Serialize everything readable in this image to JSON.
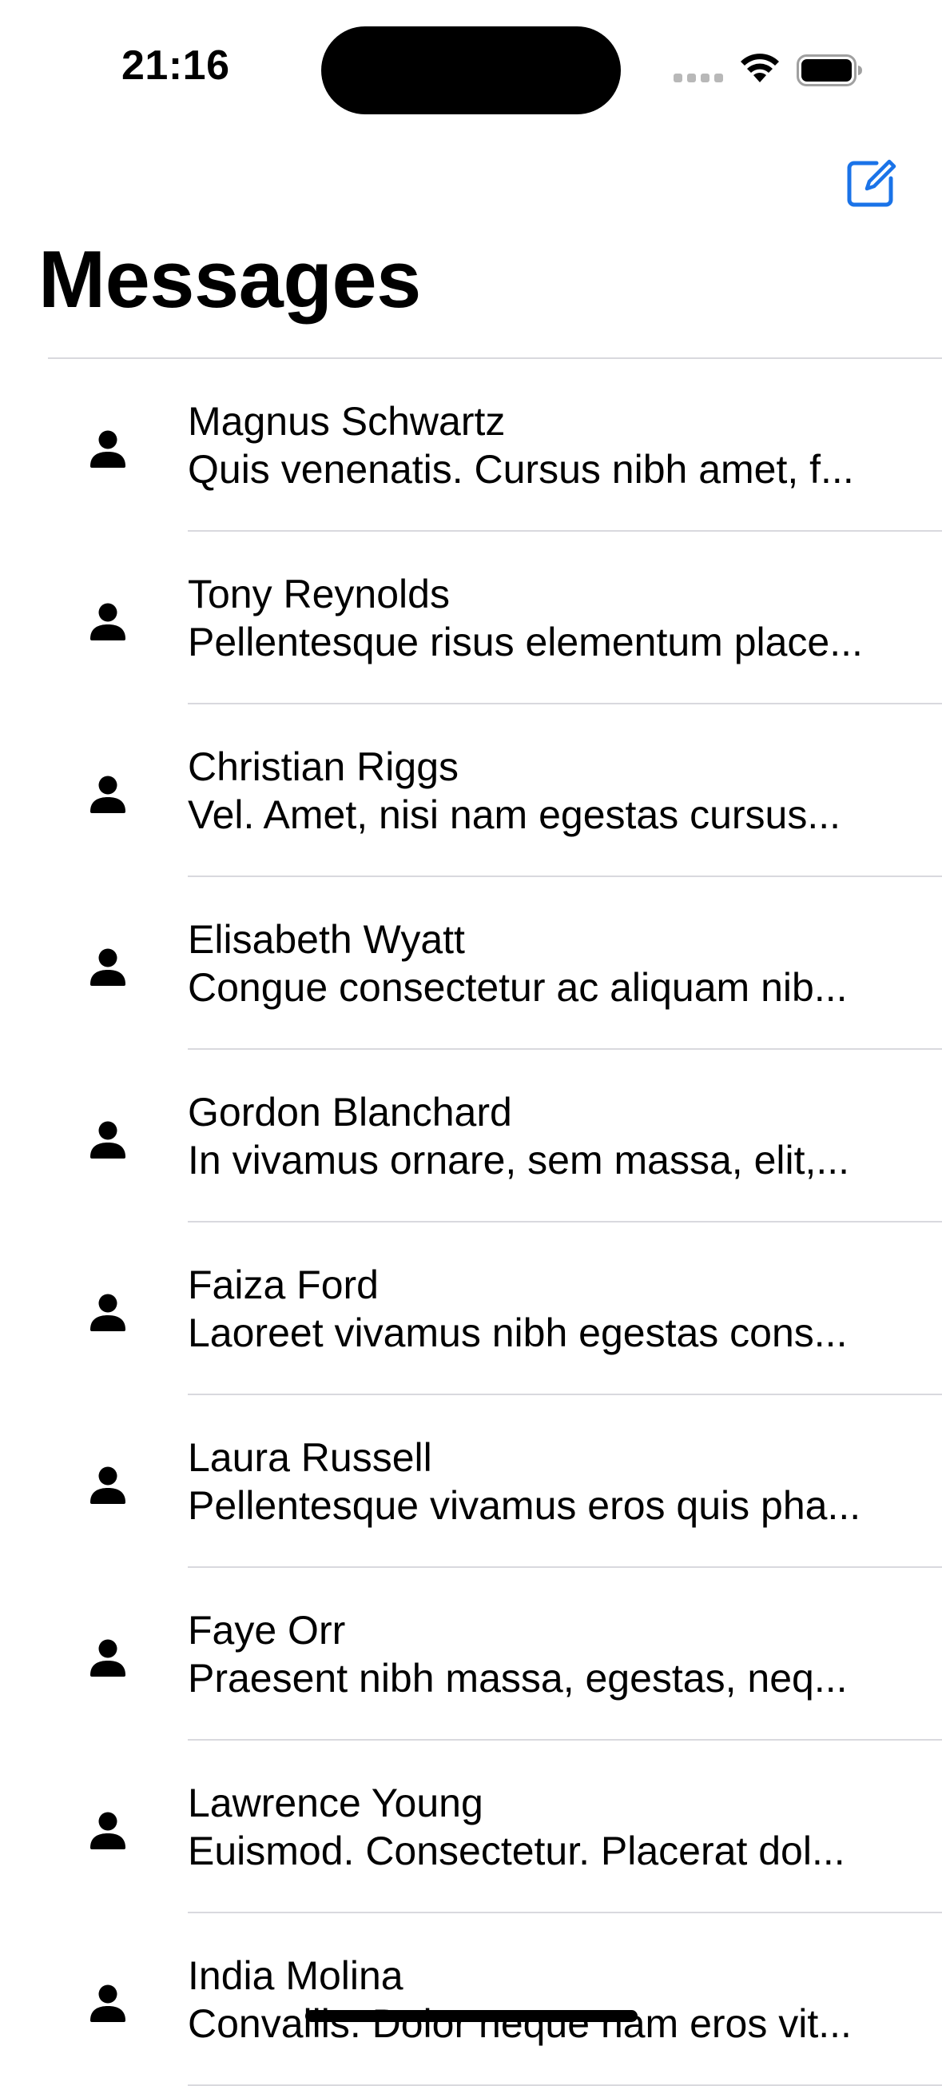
{
  "status_bar": {
    "time": "21:16"
  },
  "nav": {
    "title": "Messages",
    "compose_icon": "square-and-pencil-icon",
    "accent_color": "#1a73e8"
  },
  "messages": [
    {
      "name": "Magnus Schwartz",
      "preview": "Quis venenatis. Cursus nibh amet, f..."
    },
    {
      "name": "Tony Reynolds",
      "preview": "Pellentesque risus elementum place..."
    },
    {
      "name": "Christian Riggs",
      "preview": "Vel. Amet, nisi nam egestas cursus..."
    },
    {
      "name": "Elisabeth Wyatt",
      "preview": "Congue consectetur ac aliquam nib..."
    },
    {
      "name": "Gordon Blanchard",
      "preview": "In vivamus ornare, sem massa, elit,..."
    },
    {
      "name": "Faiza Ford",
      "preview": "Laoreet vivamus nibh egestas cons..."
    },
    {
      "name": "Laura Russell",
      "preview": "Pellentesque vivamus eros quis pha..."
    },
    {
      "name": "Faye Orr",
      "preview": "Praesent nibh massa, egestas, neq..."
    },
    {
      "name": "Lawrence Young",
      "preview": "Euismod. Consectetur. Placerat dol..."
    },
    {
      "name": "India Molina",
      "preview": "Convallis. Dolor neque nam eros vit..."
    }
  ]
}
